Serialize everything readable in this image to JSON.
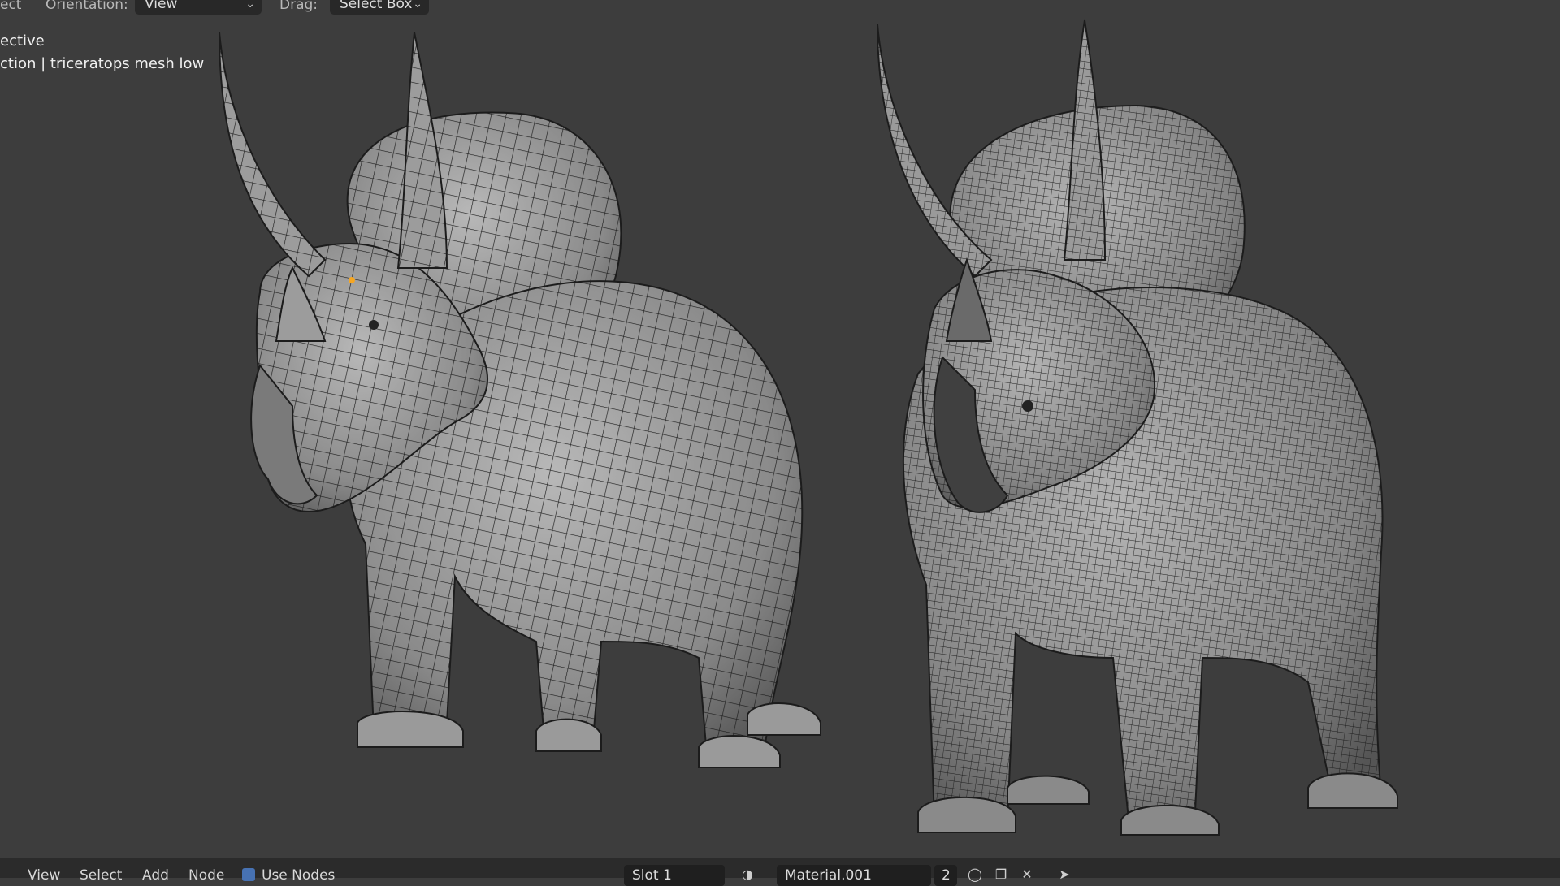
{
  "header": {
    "select_partial": "ect",
    "orientation_label": "Orientation:",
    "orientation_value": "View",
    "drag_label": "Drag:",
    "drag_value": "Select Box"
  },
  "overlay": {
    "view_mode": "ective",
    "collection_text": "ction | triceratops mesh low"
  },
  "bottom_bar": {
    "menus": [
      "View",
      "Select",
      "Add",
      "Node"
    ],
    "use_nodes_label": "Use Nodes",
    "slot_value": "Slot 1",
    "material_value": "Material.001",
    "user_count": "2"
  },
  "colors": {
    "viewport_bg": "#3d3d3d",
    "mesh_fill": "#8e8e8e",
    "wire": "#1c1c1c",
    "origin_dot": "#f5a623",
    "checkbox_accent": "#4772b3"
  },
  "icons": {
    "orientation_chevron": "chevron-down-icon",
    "drag_chevron": "chevron-down-icon",
    "material_sphere": "material-sphere-icon",
    "fake_user": "shield-icon",
    "duplicate": "duplicate-icon",
    "unlink": "close-icon",
    "pin": "pin-icon"
  }
}
